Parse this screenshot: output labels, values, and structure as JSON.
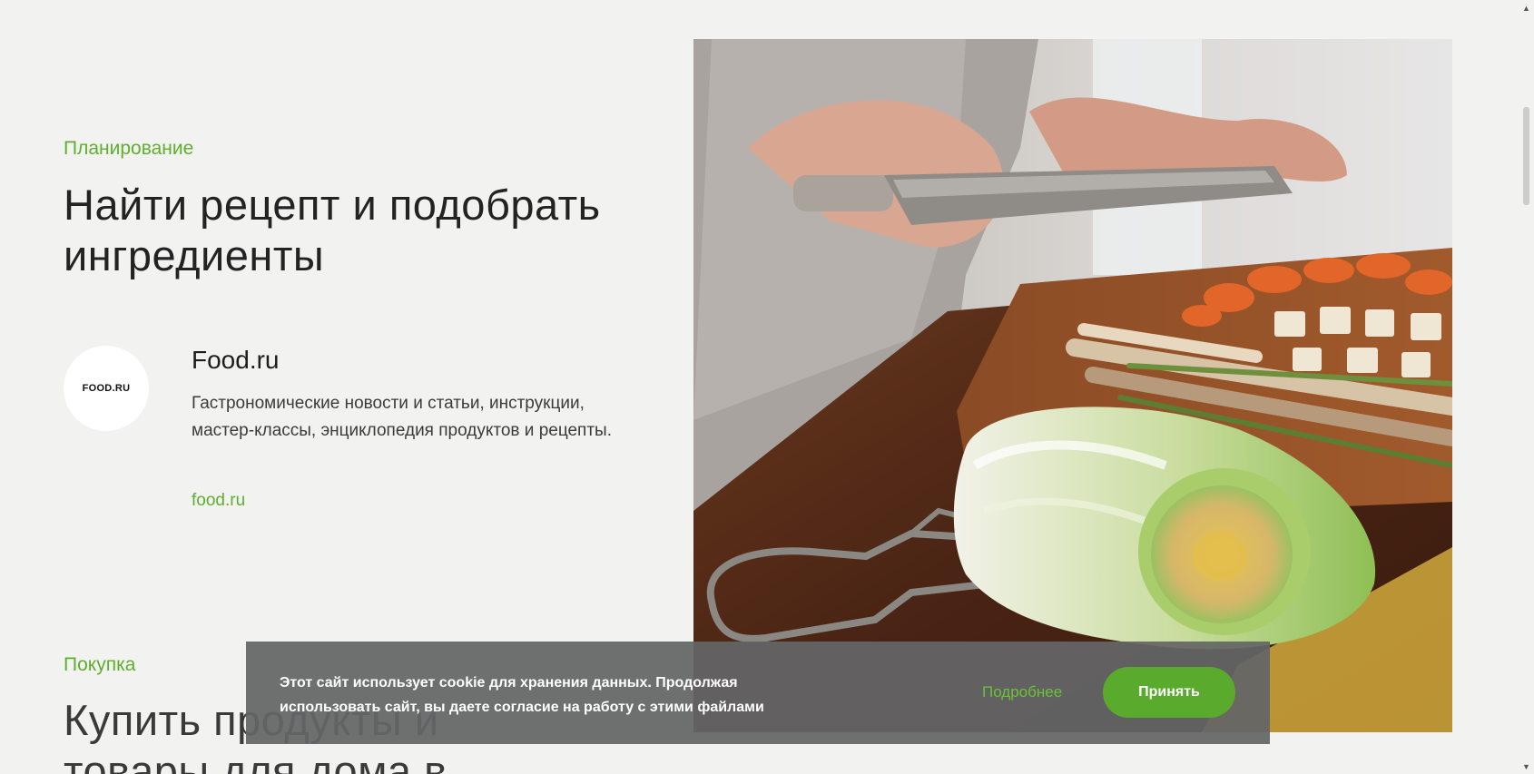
{
  "section1": {
    "eyebrow": "Планирование",
    "title": "Найти рецепт и подобрать ингредиенты",
    "partner": {
      "logo_text": "FOOD.RU",
      "name": "Food.ru",
      "description": "Гастрономические новости и статьи, инструкции, мастер-классы, энциклопедия продуктов и рецепты.",
      "link": "food.ru"
    }
  },
  "section2": {
    "eyebrow": "Покупка",
    "title": "Купить продукты и товары для дома в"
  },
  "cookie_banner": {
    "text": "Этот сайт использует cookie для хранения данных. Продолжая использовать сайт, вы даете согласие на работу с этими файлами",
    "more_label": "Подробнее",
    "accept_label": "Принять"
  },
  "colors": {
    "accent": "#5fae2e",
    "background": "#f2f3f1",
    "banner": "#646566"
  }
}
